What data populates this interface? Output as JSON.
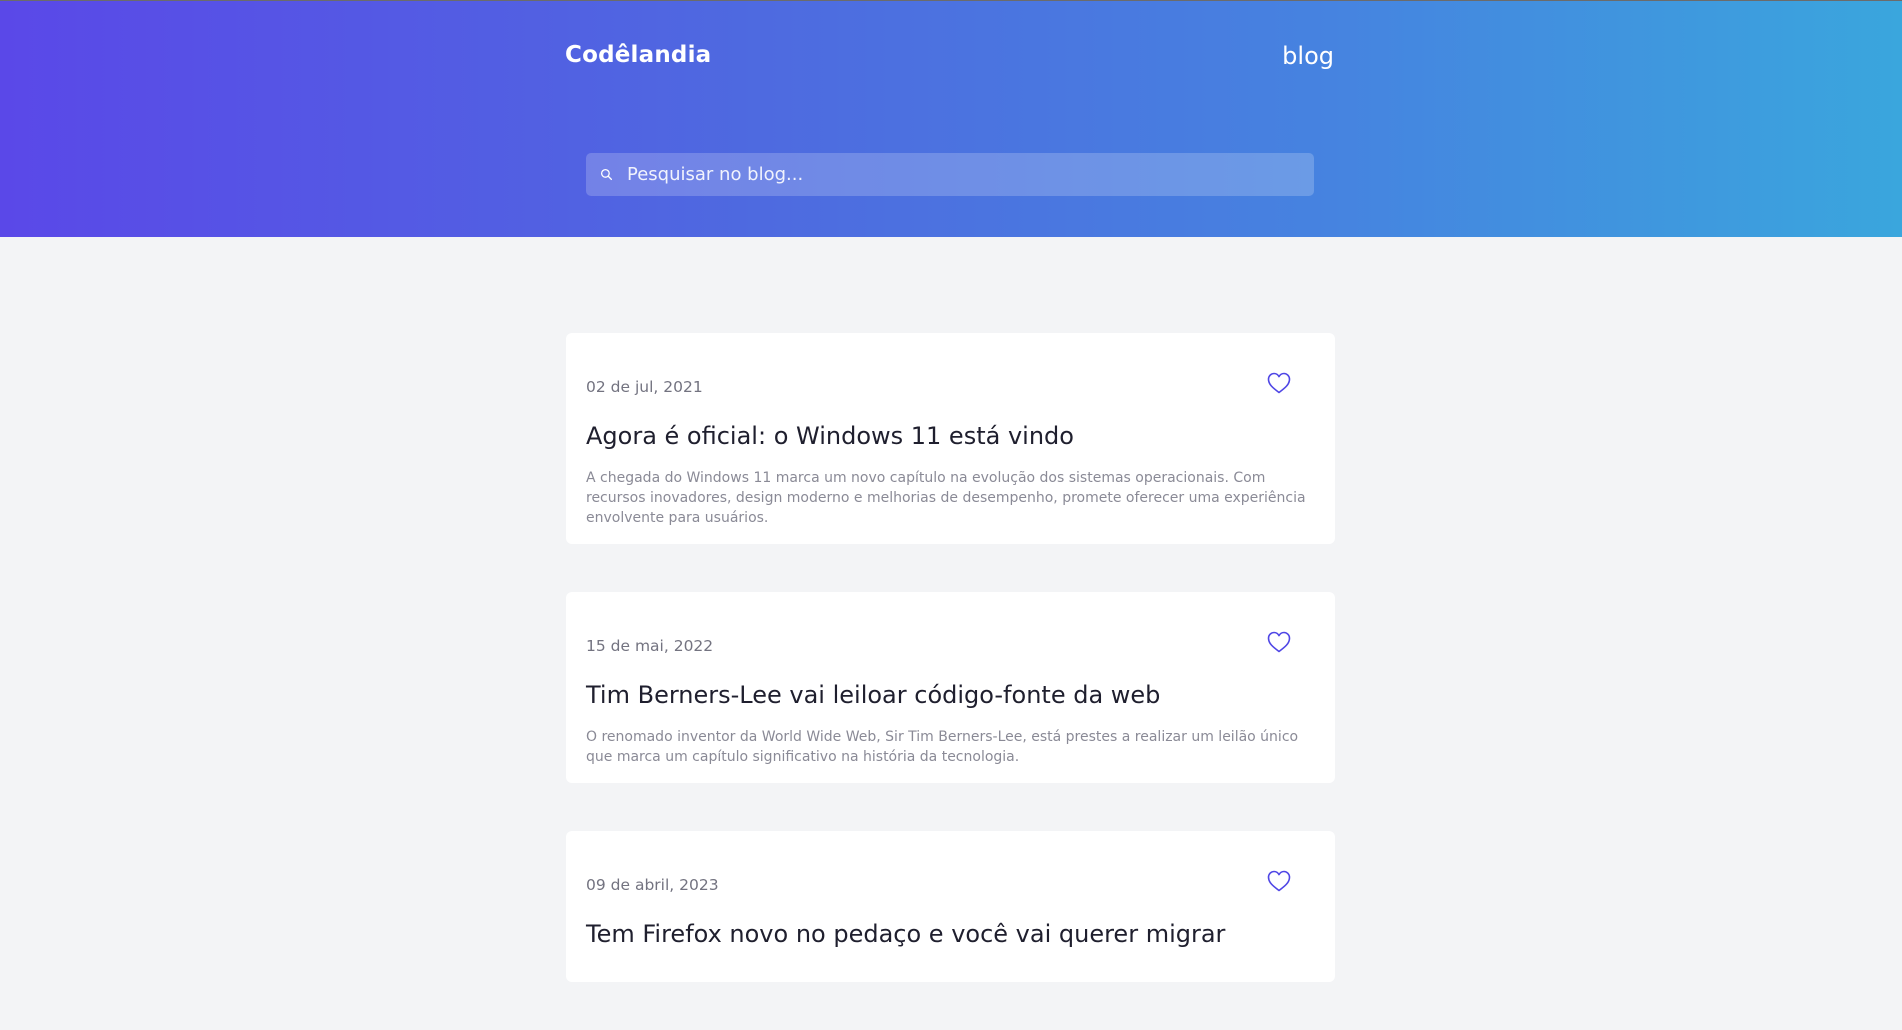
{
  "header": {
    "brand": "Codêlandia",
    "nav_link": "blog",
    "search": {
      "placeholder": "Pesquisar no blog...",
      "value": ""
    },
    "gradient_colors": [
      "#5a48e8",
      "#3aa6dd"
    ]
  },
  "accent_color": "#4f46e5",
  "posts": [
    {
      "date": "02 de jul, 2021",
      "title": "Agora é oficial: o Windows 11 está vindo",
      "excerpt": "A chegada do Windows 11 marca um novo capítulo na evolução dos sistemas operacionais. Com recursos inovadores, design moderno e melhorias de desempenho, promete oferecer uma experiência envolvente para usuários.",
      "icon": "heart-icon"
    },
    {
      "date": "15 de mai, 2022",
      "title": "Tim Berners-Lee vai leiloar código-fonte da web",
      "excerpt": "O renomado inventor da World Wide Web, Sir Tim Berners-Lee, está prestes a realizar um leilão único que marca um capítulo significativo na história da tecnologia.",
      "icon": "heart-icon"
    },
    {
      "date": "09 de abril, 2023",
      "title": "Tem Firefox novo no pedaço e você vai querer migrar",
      "excerpt": "",
      "icon": "heart-icon"
    }
  ]
}
